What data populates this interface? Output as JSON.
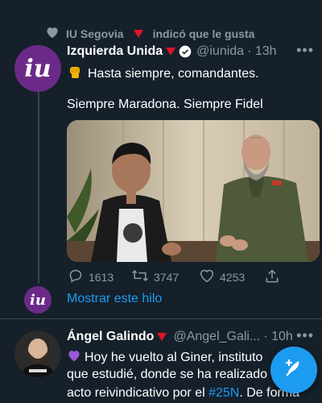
{
  "liked_by": {
    "user": "IU Segovia",
    "text": "indicó que le gusta"
  },
  "tweet1": {
    "display_name": "Izquierda Unida",
    "handle": "@iunida",
    "time": "· 13h",
    "line1": "Hasta siempre, comandantes.",
    "line2": "Siempre Maradona. Siempre Fidel",
    "replies": "1613",
    "retweets": "3747",
    "likes": "4253",
    "avatar_text": "iu"
  },
  "thread": {
    "avatar_text": "iu",
    "show_thread": "Mostrar este hilo"
  },
  "tweet2": {
    "display_name": "Ángel Galindo",
    "handle": "@Angel_Gali...",
    "time": "· 10h",
    "line1": "Hoy he vuelto al Giner, instituto",
    "line2": "que estudié, donde se ha realizado",
    "line3_pre": "acto reivindicativo por el ",
    "hashtag": "#25N",
    "line3_post": ". De forma"
  },
  "colors": {
    "background": "#15202b",
    "accent": "#1d9bf0",
    "muted": "#8b98a5",
    "iu_purple": "#6b2a87"
  }
}
